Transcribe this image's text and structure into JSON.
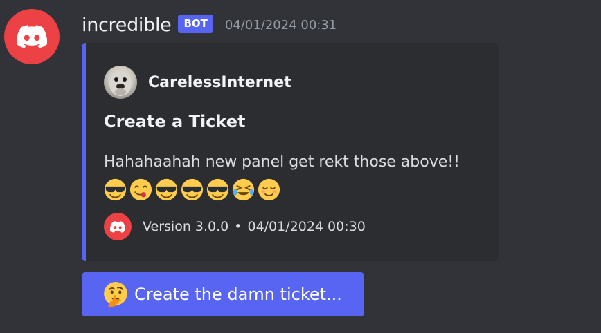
{
  "message": {
    "author": {
      "username": "incredible",
      "bot_tag": "BOT",
      "avatar_icon": "discord-logo-icon",
      "avatar_color": "#ed4245"
    },
    "timestamp": "04/01/2024 00:31"
  },
  "embed": {
    "accent_color": "#5865f2",
    "author_name": "CarelessInternet",
    "title": "Create a Ticket",
    "description": "Hahahaahah new panel get rekt those above!!",
    "emojis": [
      "sunglasses",
      "yum",
      "sunglasses",
      "sunglasses",
      "sunglasses",
      "rofl",
      "relaxed"
    ],
    "footer": {
      "icon": "discord-logo-icon",
      "version": "Version 3.0.0",
      "separator": "•",
      "timestamp": "04/01/2024 00:30"
    }
  },
  "button": {
    "emoji": "thinking-face",
    "label": "Create the damn ticket...",
    "color": "#5865f2"
  }
}
